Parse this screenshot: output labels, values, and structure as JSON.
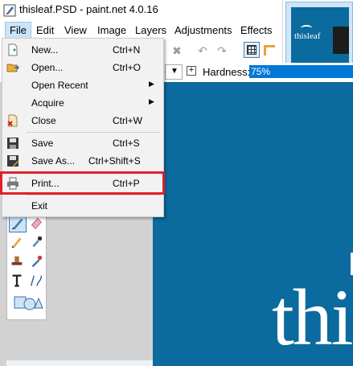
{
  "window": {
    "title": "thisleaf.PSD - paint.net 4.0.16"
  },
  "menubar": [
    {
      "label": "File",
      "active": true
    },
    {
      "label": "Edit"
    },
    {
      "label": "View"
    },
    {
      "label": "Image"
    },
    {
      "label": "Layers"
    },
    {
      "label": "Adjustments"
    },
    {
      "label": "Effects"
    }
  ],
  "file_menu": {
    "items": [
      {
        "label": "New...",
        "shortcut": "Ctrl+N",
        "icon": "new-file-icon"
      },
      {
        "label": "Open...",
        "shortcut": "Ctrl+O",
        "icon": "open-folder-icon"
      },
      {
        "label": "Open Recent",
        "submenu": true
      },
      {
        "label": "Acquire",
        "submenu": true
      },
      {
        "label": "Close",
        "shortcut": "Ctrl+W",
        "icon": "close-file-icon"
      },
      {
        "label": "Save",
        "shortcut": "Ctrl+S",
        "icon": "save-icon"
      },
      {
        "label": "Save As...",
        "shortcut": "Ctrl+Shift+S",
        "icon": "save-as-icon"
      },
      {
        "label": "Print...",
        "shortcut": "Ctrl+P",
        "icon": "printer-icon",
        "highlighted": true
      },
      {
        "label": "Exit"
      }
    ],
    "highlight_color": "#e0202a"
  },
  "tool_options": {
    "hardness_label": "Hardness:",
    "hardness_value": "75%",
    "hardness_fraction": 0.75
  },
  "thumbnail": {
    "image_text": "thisleaf"
  },
  "canvas": {
    "visible_text": "thi"
  },
  "colors": {
    "canvas_blue": "#0b6a9e",
    "menu_active_bg": "#cce4f7",
    "slider_blue": "#0078d7"
  }
}
